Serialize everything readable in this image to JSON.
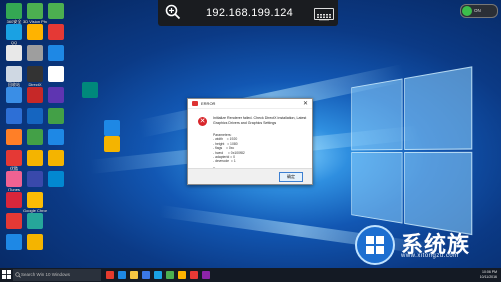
{
  "remote_toolbar": {
    "address": "192.168.199.124",
    "zoom_icon": "zoom-in-icon",
    "keyboard_icon": "keyboard-icon"
  },
  "status": {
    "label": "ON"
  },
  "desktop_icons": [
    {
      "label": "360安全",
      "color": "#34a853"
    },
    {
      "label": "QQ",
      "color": "#1aa1e3"
    },
    {
      "label": "",
      "color": "#e8e8e8"
    },
    {
      "label": "回收站",
      "color": "#cfd8e3"
    },
    {
      "label": "",
      "color": "#3a8ee6"
    },
    {
      "label": "",
      "color": "#2d6fd6"
    },
    {
      "label": "",
      "color": "#ff7f27"
    },
    {
      "label": "优酷",
      "color": "#e53935"
    },
    {
      "label": "iTunes",
      "color": "#f06292"
    },
    {
      "label": "",
      "color": "#d9263b"
    },
    {
      "label": "",
      "color": "#e53935"
    },
    {
      "label": "",
      "color": "#1e88e5"
    },
    {
      "label": "3D Vision Photo Viewer",
      "color": "#4caf50"
    },
    {
      "label": "",
      "color": "#ffb300"
    },
    {
      "label": "",
      "color": "#9e9e9e"
    },
    {
      "label": "DirectX",
      "color": "#333333"
    },
    {
      "label": "",
      "color": "#c62828"
    },
    {
      "label": "",
      "color": "#1565c0"
    },
    {
      "label": "",
      "color": "#43a047"
    },
    {
      "label": "",
      "color": "#f4b400"
    },
    {
      "label": "",
      "color": "#3949ab"
    },
    {
      "label": "Google Chrome",
      "color": "#fbbc05"
    },
    {
      "label": "",
      "color": "#26a69a"
    },
    {
      "label": "",
      "color": "#f4b400"
    },
    {
      "label": "",
      "color": "#4caf50"
    },
    {
      "label": "",
      "color": "#e53935"
    },
    {
      "label": "",
      "color": "#1e88e5"
    },
    {
      "label": "",
      "color": "#ffffff"
    },
    {
      "label": "",
      "color": "#5e35b1"
    },
    {
      "label": "",
      "color": "#43a047"
    },
    {
      "label": "",
      "color": "#1e88e5"
    },
    {
      "label": "",
      "color": "#f4b400"
    },
    {
      "label": "",
      "color": "#0288d1"
    },
    {
      "label": "",
      "color": "#00897b"
    },
    {
      "label": "",
      "color": "#1e88e5"
    },
    {
      "label": "",
      "color": "#f4b400"
    }
  ],
  "dialog": {
    "title": "ERROR",
    "message": "Initialize Renderer failed. Check DirectX installation, Latest Graphics Drivers and Graphics Settings",
    "params_heading": "Parameters:",
    "params": "- width    = 1920\n- height   = 1080\n- flags    = 0xc\n- hwnd     = 0x100f82\n- adapterid = 0\n- devmode  = 1",
    "footer_text": "Error:",
    "ok_label": "确定"
  },
  "taskbar": {
    "search_placeholder": "Search Win 10 Windows",
    "time": "10:06 PM",
    "date": "10/11/2016"
  },
  "watermark": {
    "brand": "系统族",
    "sub": "www.xitongzu.com"
  },
  "colors": {
    "dialog_error": "#d8262b",
    "ok_border": "#3c7fd1"
  }
}
